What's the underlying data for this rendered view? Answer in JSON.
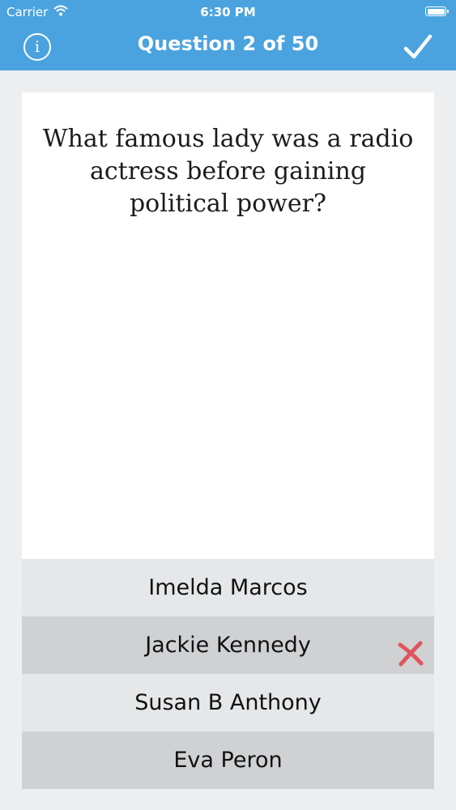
{
  "status_bar": {
    "carrier": "Carrier",
    "time": "6:30 PM",
    "wifi_icon": "wifi-icon",
    "battery_icon": "battery-icon"
  },
  "nav": {
    "title": "Question 2 of 50",
    "info_icon_text": "i",
    "info_icon": "info-icon",
    "done_icon": "checkmark-icon"
  },
  "question": {
    "text": "What famous lady was a radio actress before gaining political power?"
  },
  "answers": [
    {
      "label": "Imelda Marcos",
      "state": "none"
    },
    {
      "label": "Jackie Kennedy",
      "state": "wrong"
    },
    {
      "label": "Susan B Anthony",
      "state": "none"
    },
    {
      "label": "Eva Peron",
      "state": "none"
    }
  ],
  "colors": {
    "header": "#4aa3de",
    "background": "#eceef0",
    "answer_light": "#e6e7e9",
    "answer_dark": "#d0d1d3",
    "wrong_mark": "#e0545e"
  }
}
